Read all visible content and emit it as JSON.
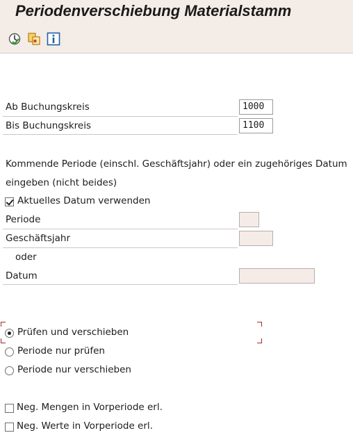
{
  "title": "Periodenverschiebung Materialstamm",
  "toolbar": {
    "icons": [
      "execute-icon",
      "copy-variant-icon",
      "info-icon"
    ]
  },
  "company_code": {
    "from_label": "Ab Buchungskreis",
    "from_value": "1000",
    "to_label": "Bis Buchungskreis",
    "to_value": "1100"
  },
  "instructions": {
    "line1": "Kommende Periode (einschl. Geschäftsjahr) oder ein zugehöriges Datum",
    "line2": "eingeben (nicht beides)"
  },
  "current_date": {
    "label": "Aktuelles Datum verwenden",
    "checked": true
  },
  "period": {
    "label": "Periode",
    "value": ""
  },
  "fiscal_year": {
    "label": "Geschäftsjahr",
    "value": ""
  },
  "or_label": "oder",
  "date": {
    "label": "Datum",
    "value": ""
  },
  "mode": {
    "options": [
      {
        "label": "Prüfen und verschieben",
        "selected": true
      },
      {
        "label": "Periode nur prüfen",
        "selected": false
      },
      {
        "label": "Periode nur verschieben",
        "selected": false
      }
    ]
  },
  "negative": {
    "qty_label": "Neg. Mengen in Vorperiode erl.",
    "qty_checked": false,
    "val_label": "Neg. Werte in Vorperiode erl.",
    "val_checked": false
  },
  "colors": {
    "header_bg": "#f4ece7",
    "focus": "#9b2b2b",
    "empty_field": "#f6ece7"
  }
}
